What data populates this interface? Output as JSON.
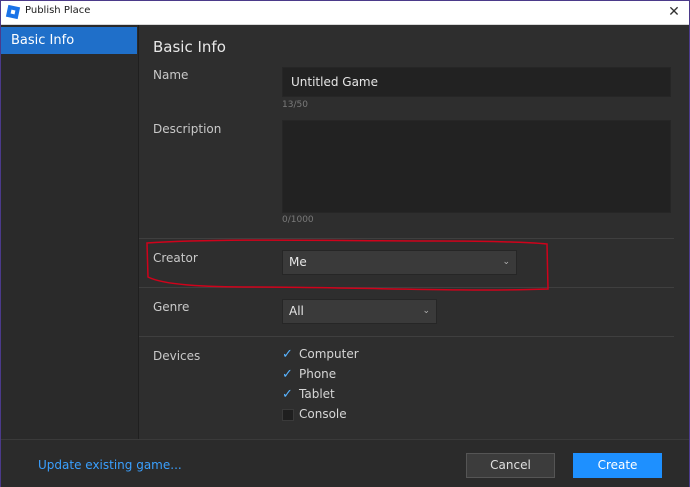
{
  "window": {
    "title": "Publish Place",
    "close_glyph": "✕"
  },
  "sidebar": {
    "items": [
      {
        "label": "Basic Info",
        "selected": true
      }
    ]
  },
  "main": {
    "heading": "Basic Info",
    "name": {
      "label": "Name",
      "value": "Untitled Game",
      "counter": "13/50"
    },
    "description": {
      "label": "Description",
      "value": "",
      "counter": "0/1000"
    },
    "creator": {
      "label": "Creator",
      "value": "Me"
    },
    "genre": {
      "label": "Genre",
      "value": "All"
    },
    "devices": {
      "label": "Devices",
      "options": [
        {
          "label": "Computer",
          "checked": true
        },
        {
          "label": "Phone",
          "checked": true
        },
        {
          "label": "Tablet",
          "checked": true
        },
        {
          "label": "Console",
          "checked": false
        }
      ]
    }
  },
  "footer": {
    "update_link": "Update existing game...",
    "cancel_label": "Cancel",
    "create_label": "Create"
  },
  "colors": {
    "accent": "#1e90ff",
    "annotation": "#d0021b"
  },
  "icons": {
    "app": "roblox-studio-icon",
    "close": "close-icon",
    "dropdown": "chevron-down-icon",
    "check": "checkmark-icon"
  }
}
